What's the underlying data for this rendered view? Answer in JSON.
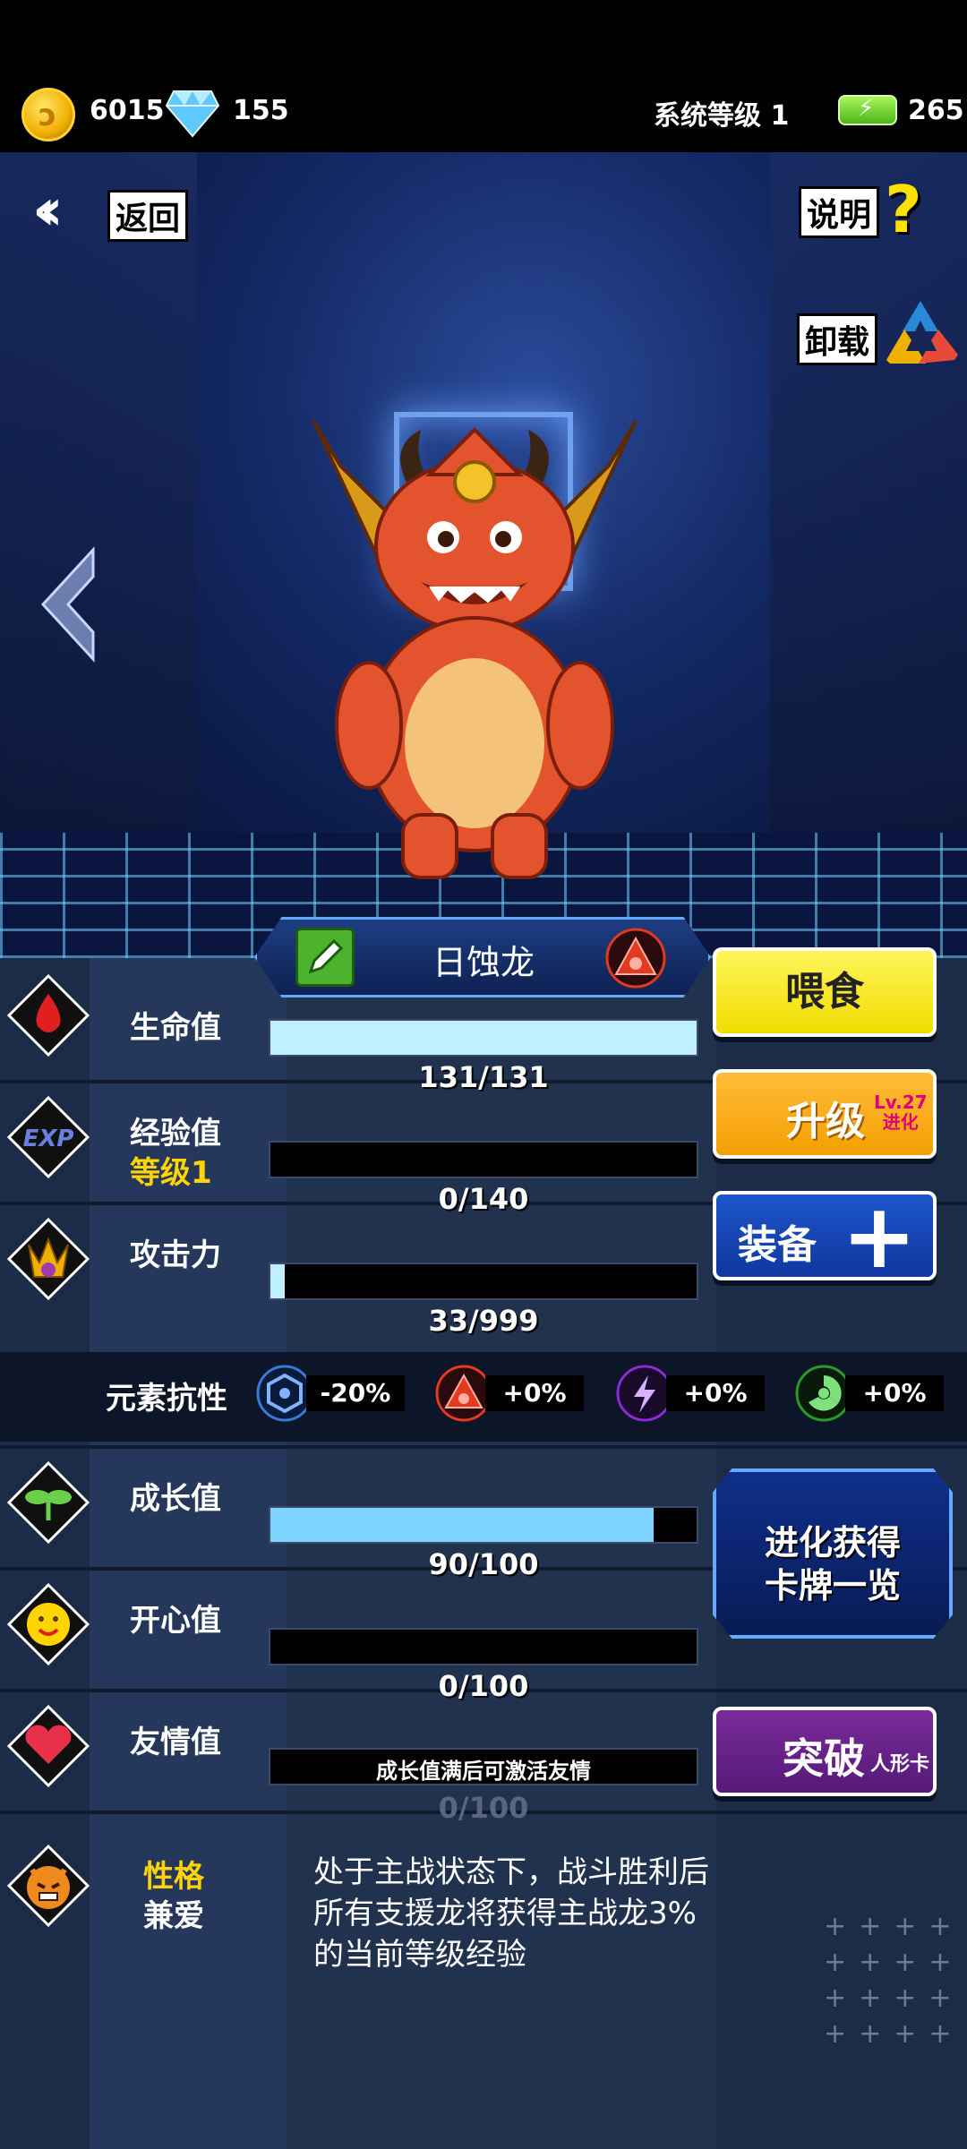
{
  "currency": {
    "coins": "6015",
    "gems": "155"
  },
  "system_level": "系统等级 1",
  "energy": "265",
  "nav": {
    "back_label": "返回",
    "help_label": "说明",
    "unload_label": "卸载"
  },
  "pet": {
    "name": "日蚀龙"
  },
  "stats": {
    "hp": {
      "label": "生命值",
      "value": "131/131",
      "fill": 1.0
    },
    "exp": {
      "label": "经验值",
      "sub": "等级1",
      "value": "0/140",
      "fill": 0.0
    },
    "atk": {
      "label": "攻击力",
      "value": "33/999",
      "fill": 0.033
    },
    "growth": {
      "label": "成长值",
      "value": "90/100",
      "fill": 0.9
    },
    "happy": {
      "label": "开心值",
      "value": "0/100",
      "fill": 0.0
    },
    "friend": {
      "label": "友情值",
      "message": "成长值满后可激活友情",
      "value": "0/100",
      "fill": 0.0
    }
  },
  "resistance": {
    "label": "元素抗性",
    "items": [
      {
        "icon": "water-element-icon",
        "value": "-20%",
        "color": "#3a78d8"
      },
      {
        "icon": "fire-element-icon",
        "value": "+0%",
        "color": "#e23a1e"
      },
      {
        "icon": "thunder-element-icon",
        "value": "+0%",
        "color": "#8a2ad8"
      },
      {
        "icon": "poison-element-icon",
        "value": "+0%",
        "color": "#2a9a2a"
      }
    ]
  },
  "buttons": {
    "feed": "喂食",
    "upgrade": "升级",
    "upgrade_lv": "Lv.27",
    "upgrade_evo": "进化",
    "equip": "装备",
    "evolution_list_line1": "进化获得",
    "evolution_list_line2": "卡牌一览",
    "breakthrough": "突破",
    "breakthrough_sub": "人形卡"
  },
  "personality": {
    "label": "性格",
    "type": "兼爱",
    "description": "处于主战状态下，战斗胜利后所有支援龙将获得主战龙3%的当前等级经验"
  },
  "colors": {
    "accent_yellow": "#ffd400",
    "hp_fill": "#bff0ff",
    "growth_fill": "#7fd4ff",
    "atk_fill": "#bff0ff"
  }
}
